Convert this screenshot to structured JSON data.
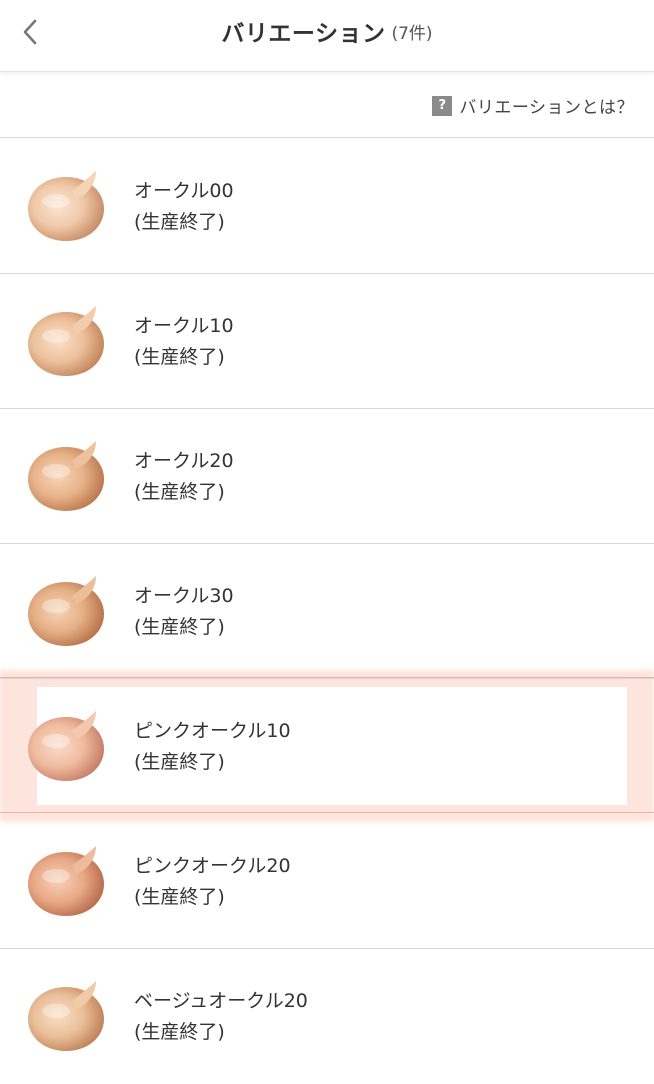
{
  "header": {
    "title": "バリエーション",
    "count": "(7件)",
    "back_icon": "chevron-left-icon"
  },
  "help": {
    "icon_text": "?",
    "label": "バリエーションとは？"
  },
  "variations": [
    {
      "name": "オークル00",
      "status": "(生産終了)",
      "color": "#f0c9a8",
      "selected": false
    },
    {
      "name": "オークル10",
      "status": "(生産終了)",
      "color": "#edc19d",
      "selected": false
    },
    {
      "name": "オークル20",
      "status": "(生産終了)",
      "color": "#e8b38a",
      "selected": false
    },
    {
      "name": "オークル30",
      "status": "(生産終了)",
      "color": "#e6b086",
      "selected": false
    },
    {
      "name": "ピンクオークル10",
      "status": "(生産終了)",
      "color": "#f0bc9f",
      "selected": true
    },
    {
      "name": "ピンクオークル20",
      "status": "(生産終了)",
      "color": "#e9aa88",
      "selected": false
    },
    {
      "name": "ベージュオークル20",
      "status": "(生産終了)",
      "color": "#eabf9a",
      "selected": false
    }
  ],
  "colors": {
    "selected_highlight": "#fac4b4",
    "divider": "#d9d9d9"
  }
}
